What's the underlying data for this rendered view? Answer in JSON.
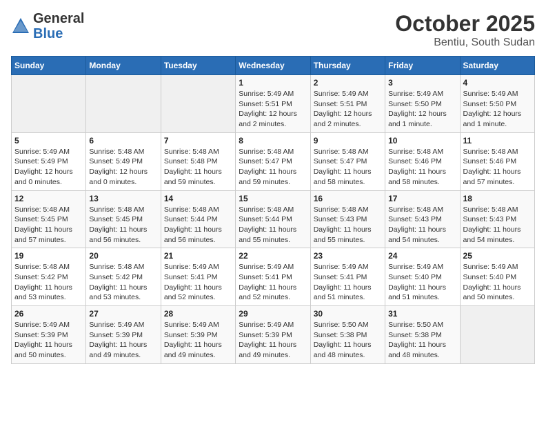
{
  "header": {
    "logo_general": "General",
    "logo_blue": "Blue",
    "month_title": "October 2025",
    "location": "Bentiu, South Sudan"
  },
  "weekdays": [
    "Sunday",
    "Monday",
    "Tuesday",
    "Wednesday",
    "Thursday",
    "Friday",
    "Saturday"
  ],
  "weeks": [
    [
      {
        "day": "",
        "info": ""
      },
      {
        "day": "",
        "info": ""
      },
      {
        "day": "",
        "info": ""
      },
      {
        "day": "1",
        "info": "Sunrise: 5:49 AM\nSunset: 5:51 PM\nDaylight: 12 hours\nand 2 minutes."
      },
      {
        "day": "2",
        "info": "Sunrise: 5:49 AM\nSunset: 5:51 PM\nDaylight: 12 hours\nand 2 minutes."
      },
      {
        "day": "3",
        "info": "Sunrise: 5:49 AM\nSunset: 5:50 PM\nDaylight: 12 hours\nand 1 minute."
      },
      {
        "day": "4",
        "info": "Sunrise: 5:49 AM\nSunset: 5:50 PM\nDaylight: 12 hours\nand 1 minute."
      }
    ],
    [
      {
        "day": "5",
        "info": "Sunrise: 5:49 AM\nSunset: 5:49 PM\nDaylight: 12 hours\nand 0 minutes."
      },
      {
        "day": "6",
        "info": "Sunrise: 5:48 AM\nSunset: 5:49 PM\nDaylight: 12 hours\nand 0 minutes."
      },
      {
        "day": "7",
        "info": "Sunrise: 5:48 AM\nSunset: 5:48 PM\nDaylight: 11 hours\nand 59 minutes."
      },
      {
        "day": "8",
        "info": "Sunrise: 5:48 AM\nSunset: 5:47 PM\nDaylight: 11 hours\nand 59 minutes."
      },
      {
        "day": "9",
        "info": "Sunrise: 5:48 AM\nSunset: 5:47 PM\nDaylight: 11 hours\nand 58 minutes."
      },
      {
        "day": "10",
        "info": "Sunrise: 5:48 AM\nSunset: 5:46 PM\nDaylight: 11 hours\nand 58 minutes."
      },
      {
        "day": "11",
        "info": "Sunrise: 5:48 AM\nSunset: 5:46 PM\nDaylight: 11 hours\nand 57 minutes."
      }
    ],
    [
      {
        "day": "12",
        "info": "Sunrise: 5:48 AM\nSunset: 5:45 PM\nDaylight: 11 hours\nand 57 minutes."
      },
      {
        "day": "13",
        "info": "Sunrise: 5:48 AM\nSunset: 5:45 PM\nDaylight: 11 hours\nand 56 minutes."
      },
      {
        "day": "14",
        "info": "Sunrise: 5:48 AM\nSunset: 5:44 PM\nDaylight: 11 hours\nand 56 minutes."
      },
      {
        "day": "15",
        "info": "Sunrise: 5:48 AM\nSunset: 5:44 PM\nDaylight: 11 hours\nand 55 minutes."
      },
      {
        "day": "16",
        "info": "Sunrise: 5:48 AM\nSunset: 5:43 PM\nDaylight: 11 hours\nand 55 minutes."
      },
      {
        "day": "17",
        "info": "Sunrise: 5:48 AM\nSunset: 5:43 PM\nDaylight: 11 hours\nand 54 minutes."
      },
      {
        "day": "18",
        "info": "Sunrise: 5:48 AM\nSunset: 5:43 PM\nDaylight: 11 hours\nand 54 minutes."
      }
    ],
    [
      {
        "day": "19",
        "info": "Sunrise: 5:48 AM\nSunset: 5:42 PM\nDaylight: 11 hours\nand 53 minutes."
      },
      {
        "day": "20",
        "info": "Sunrise: 5:48 AM\nSunset: 5:42 PM\nDaylight: 11 hours\nand 53 minutes."
      },
      {
        "day": "21",
        "info": "Sunrise: 5:49 AM\nSunset: 5:41 PM\nDaylight: 11 hours\nand 52 minutes."
      },
      {
        "day": "22",
        "info": "Sunrise: 5:49 AM\nSunset: 5:41 PM\nDaylight: 11 hours\nand 52 minutes."
      },
      {
        "day": "23",
        "info": "Sunrise: 5:49 AM\nSunset: 5:41 PM\nDaylight: 11 hours\nand 51 minutes."
      },
      {
        "day": "24",
        "info": "Sunrise: 5:49 AM\nSunset: 5:40 PM\nDaylight: 11 hours\nand 51 minutes."
      },
      {
        "day": "25",
        "info": "Sunrise: 5:49 AM\nSunset: 5:40 PM\nDaylight: 11 hours\nand 50 minutes."
      }
    ],
    [
      {
        "day": "26",
        "info": "Sunrise: 5:49 AM\nSunset: 5:39 PM\nDaylight: 11 hours\nand 50 minutes."
      },
      {
        "day": "27",
        "info": "Sunrise: 5:49 AM\nSunset: 5:39 PM\nDaylight: 11 hours\nand 49 minutes."
      },
      {
        "day": "28",
        "info": "Sunrise: 5:49 AM\nSunset: 5:39 PM\nDaylight: 11 hours\nand 49 minutes."
      },
      {
        "day": "29",
        "info": "Sunrise: 5:49 AM\nSunset: 5:39 PM\nDaylight: 11 hours\nand 49 minutes."
      },
      {
        "day": "30",
        "info": "Sunrise: 5:50 AM\nSunset: 5:38 PM\nDaylight: 11 hours\nand 48 minutes."
      },
      {
        "day": "31",
        "info": "Sunrise: 5:50 AM\nSunset: 5:38 PM\nDaylight: 11 hours\nand 48 minutes."
      },
      {
        "day": "",
        "info": ""
      }
    ]
  ]
}
